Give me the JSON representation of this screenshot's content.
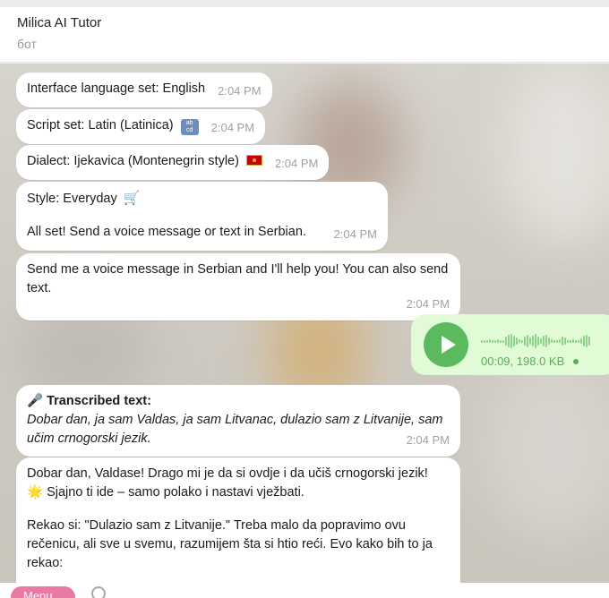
{
  "header": {
    "title": "Milica AI Tutor",
    "status": "бот"
  },
  "messages": [
    {
      "text": "Interface language set: English",
      "time": "2:04 PM"
    },
    {
      "text": "Script set: Latin (Latinica)",
      "time": "2:04 PM",
      "emoji": "abcd-icon"
    },
    {
      "text": "Dialect: Ijekavica (Montenegrin style)",
      "time": "2:04 PM",
      "emoji": "flag-montenegro-icon"
    },
    {
      "line1": "Style: Everyday",
      "line2": "All set! Send a voice message or text in Serbian.",
      "time": "2:04 PM",
      "emoji": "shopping-cart-icon"
    },
    {
      "text": "Send me a voice message in Serbian and I'll help you! You can also send text.",
      "time": "2:04 PM"
    }
  ],
  "voice": {
    "duration": "00:09",
    "size": "198.0 KB"
  },
  "transcribed": {
    "label": "Transcribed text:",
    "text": "Dobar dan, ja sam Valdas, ja sam Litvanac, dulazio sam z Litvanije, sam učim crnogorski jezik.",
    "time": "2:04 PM"
  },
  "reply": {
    "p1": "Dobar dan, Valdase! Drago mi je da si ovdje i da učiš crnogorski jezik!",
    "p1b": "Sjajno ti ide – samo polako i nastavi vježbati.",
    "p2": "Rekao si: \"Dulazio sam z Litvanije.\" Treba malo da popravimo ovu rečenicu, ali sve u svemu, razumijem šta si htio reći. Evo kako bih to ja rekao:"
  },
  "composer": {
    "menu": "Menu"
  }
}
